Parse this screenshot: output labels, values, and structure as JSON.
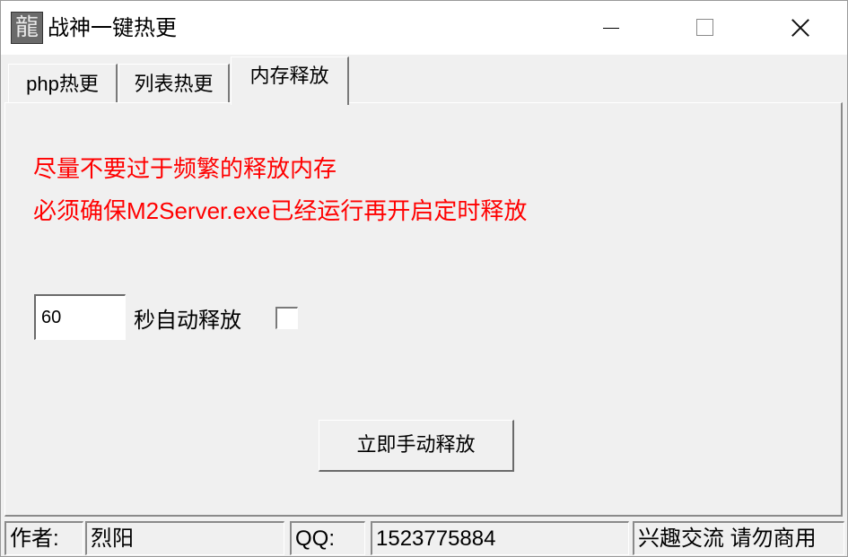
{
  "window": {
    "title": "战神一键热更",
    "icon": "dragon-character-icon",
    "icon_glyph": "龍"
  },
  "tabs": [
    {
      "label": "php热更"
    },
    {
      "label": "列表热更"
    },
    {
      "label": "内存释放"
    }
  ],
  "active_tab": 2,
  "panel": {
    "warning_line1": "尽量不要过于频繁的释放内存",
    "warning_line2": "必须确保M2Server.exe已经运行再开启定时释放",
    "warning_color": "#ff0000",
    "interval_value": "60",
    "interval_label": "秒自动释放",
    "auto_release_checked": false,
    "manual_button": "立即手动释放"
  },
  "statusbar": {
    "author_label": "作者:",
    "author_value": "烈阳",
    "qq_label": "QQ:",
    "qq_value": "1523775884",
    "note": "兴趣交流 请勿商用"
  }
}
